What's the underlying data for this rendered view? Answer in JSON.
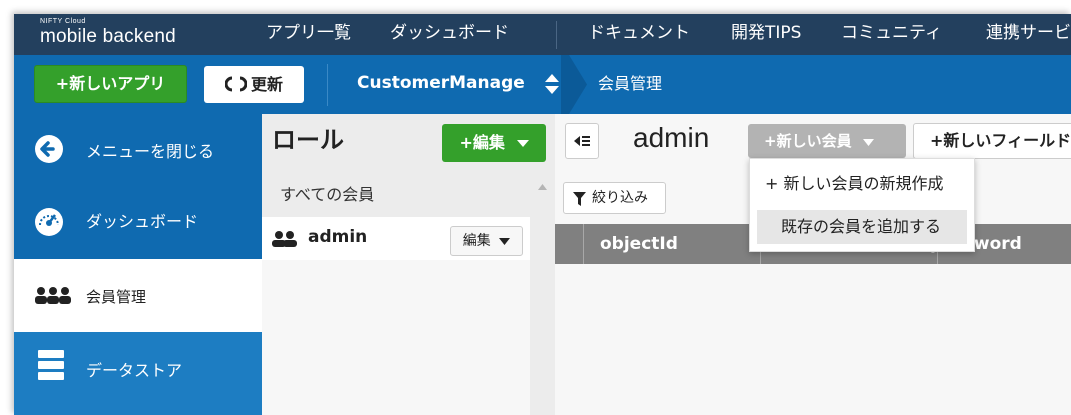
{
  "brand": {
    "small": "NIFTY Cloud",
    "big": "mobile backend"
  },
  "topnav": {
    "items": [
      "アプリ一覧",
      "ダッシュボード",
      "ドキュメント",
      "開発TIPS",
      "コミュニティ",
      "連携サービス"
    ]
  },
  "subbar": {
    "new_app_label": "+新しいアプリ",
    "refresh_label": "更新",
    "app_name": "CustomerManage",
    "breadcrumb": "会員管理"
  },
  "sidebar": {
    "items": [
      {
        "label": "メニューを閉じる",
        "icon": "arrow-left-circle-icon"
      },
      {
        "label": "ダッシュボード",
        "icon": "speedometer-icon"
      },
      {
        "label": "会員管理",
        "icon": "users-icon",
        "active": true
      },
      {
        "label": "データストア",
        "icon": "database-icon"
      }
    ]
  },
  "roles": {
    "title": "ロール",
    "edit_label": "+編集",
    "all_members": "すべての会員",
    "items": [
      {
        "name": "admin",
        "edit_label": "編集"
      }
    ]
  },
  "main": {
    "title": "admin",
    "new_member_label": "+新しい会員",
    "new_field_label": "+新しいフィールド",
    "filter_label": "絞り込み",
    "columns": [
      "objectId",
      "",
      "password"
    ]
  },
  "dropdown": {
    "items": [
      "+ 新しい会員の新規作成",
      "既存の会員を追加する"
    ],
    "highlighted_index": 1
  },
  "colors": {
    "topbar": "#23405e",
    "primary_blue": "#0f6ab0",
    "green": "#34a02b",
    "table_header": "#808080"
  }
}
